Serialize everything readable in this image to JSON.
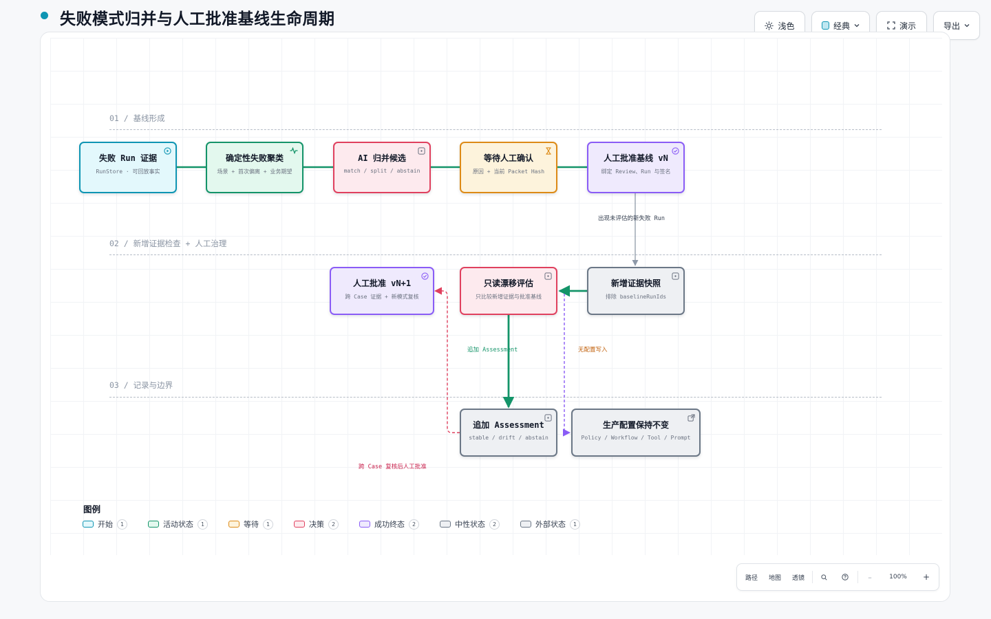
{
  "title": "失败模式归并与人工批准基线生命周期",
  "toolbar": {
    "theme_label": "浅色",
    "style_label": "经典",
    "present_label": "演示",
    "export_label": "导出"
  },
  "sections": [
    {
      "label": "01 / 基线形成"
    },
    {
      "label": "02 / 新增证据检查 + 人工治理"
    },
    {
      "label": "03 / 记录与边界"
    }
  ],
  "nodes": {
    "run": {
      "title": "失败 Run 证据",
      "sub": "RunStore · 可回放事实"
    },
    "cluster": {
      "title": "确定性失败聚类",
      "sub": "场景 + 首次偏离 + 业务期望"
    },
    "ai": {
      "title": "AI 归并候选",
      "sub": "match / split / abstain"
    },
    "wait": {
      "title": "等待人工确认",
      "sub": "原因 + 当前 Packet Hash"
    },
    "baseline": {
      "title": "人工批准基线 vN",
      "sub": "绑定 Review、Run 与签名"
    },
    "snapshot": {
      "title": "新增证据快照",
      "sub": "排除 baselineRunIds"
    },
    "drift": {
      "title": "只读漂移评估",
      "sub": "只比较新增证据与批准基线"
    },
    "next": {
      "title": "人工批准 vN+1",
      "sub": "跨 Case 证据 + 新模式复核"
    },
    "assess": {
      "title": "追加 Assessment",
      "sub": "stable / drift / abstain"
    },
    "prod": {
      "title": "生产配置保持不变",
      "sub": "Policy / Workflow / Tool / Prompt"
    }
  },
  "edges": {
    "new_run": "出现未评估的新失败 Run",
    "append": "追加 Assessment",
    "no_write": "无配置写入",
    "cross_case": "跨 Case 复核后人工批准"
  },
  "legend": {
    "title": "图例",
    "items": [
      {
        "label": "开始",
        "count": "1",
        "color": "#0e95b3",
        "fill": "#e3f8fc"
      },
      {
        "label": "活动状态",
        "count": "1",
        "color": "#149469",
        "fill": "#e3f8ee"
      },
      {
        "label": "等待",
        "count": "1",
        "color": "#dd8a16",
        "fill": "#fdf3dc"
      },
      {
        "label": "决策",
        "count": "2",
        "color": "#e0405e",
        "fill": "#fdeaee"
      },
      {
        "label": "成功终态",
        "count": "2",
        "color": "#8a5cf6",
        "fill": "#efeafd"
      },
      {
        "label": "中性状态",
        "count": "2",
        "color": "#6b7786",
        "fill": "#eef0f3"
      },
      {
        "label": "外部状态",
        "count": "1",
        "color": "#6b7786",
        "fill": "#eef0f3"
      }
    ]
  },
  "zoom": {
    "path_label": "路径",
    "map_label": "地图",
    "lens_label": "透镜",
    "level": "100%"
  },
  "colors": {
    "accent": "#0e95b3",
    "green": "#149469",
    "red": "#e0405e",
    "purple": "#8a5cf6",
    "orange": "#dd8a16",
    "gray": "#6b7786"
  }
}
